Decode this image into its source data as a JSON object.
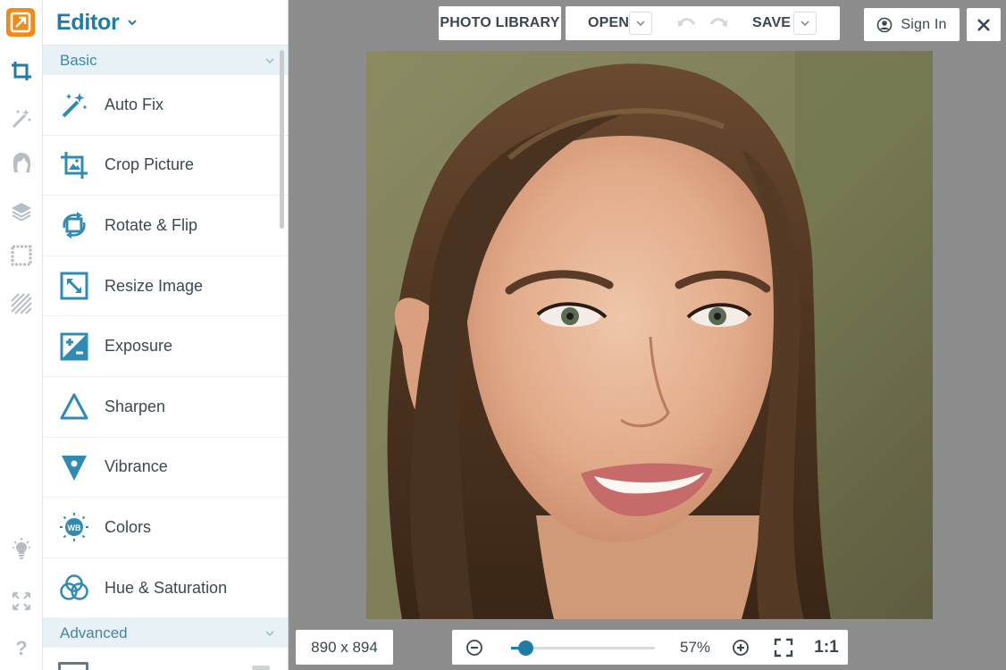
{
  "app": {
    "brand_color": "#1f7ca6",
    "logo_color": "#f28a1a"
  },
  "rail": {
    "top_icons": [
      "crop-tool-icon",
      "magic-wand-icon",
      "face-retouch-icon",
      "layers-icon",
      "frame-icon",
      "texture-icon"
    ],
    "bottom_icons": [
      "lightbulb-icon",
      "expand-icon",
      "help-icon"
    ]
  },
  "panel": {
    "title": "Editor",
    "sections": [
      {
        "label": "Basic",
        "expanded": true
      },
      {
        "label": "Advanced",
        "expanded": true
      }
    ],
    "tools": [
      {
        "label": "Auto Fix",
        "icon": "magic-wand-icon"
      },
      {
        "label": "Crop Picture",
        "icon": "crop-icon"
      },
      {
        "label": "Rotate & Flip",
        "icon": "rotate-icon"
      },
      {
        "label": "Resize Image",
        "icon": "resize-icon"
      },
      {
        "label": "Exposure",
        "icon": "exposure-icon"
      },
      {
        "label": "Sharpen",
        "icon": "sharpen-icon"
      },
      {
        "label": "Vibrance",
        "icon": "vibrance-icon"
      },
      {
        "label": "Colors",
        "icon": "white-balance-icon"
      },
      {
        "label": "Hue & Saturation",
        "icon": "hue-saturation-icon"
      }
    ]
  },
  "toolbar": {
    "photo_library": "PHOTO LIBRARY",
    "open": "OPEN",
    "save": "SAVE",
    "sign_in": "Sign In"
  },
  "canvas": {
    "image_dims": "890 x 894",
    "zoom_percent": "57%",
    "zoom_level": 0.1,
    "actual_size": "1:1"
  }
}
